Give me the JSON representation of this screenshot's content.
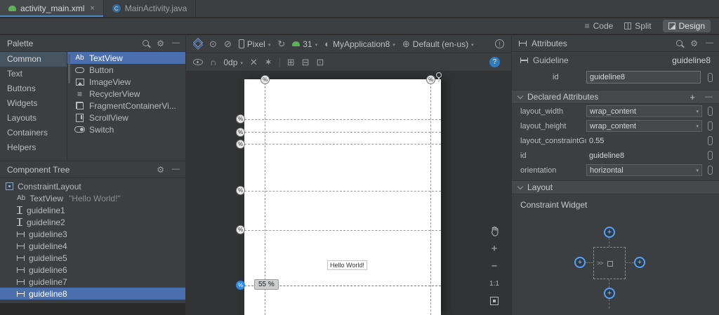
{
  "colors": {
    "selection_blue": "#4b6eaf",
    "tab_underline": "#4a88c7",
    "guideline_selected": "#2e87e5",
    "android_green": "#5fb05c"
  },
  "tabs": [
    {
      "label": "activity_main.xml",
      "close_glyph": "×"
    },
    {
      "label": "MainActivity.java",
      "icon_letter": "C"
    }
  ],
  "mode_switcher": {
    "code": "Code",
    "split": "Split",
    "design": "Design"
  },
  "palette": {
    "title": "Palette",
    "categories": [
      "Common",
      "Text",
      "Buttons",
      "Widgets",
      "Layouts",
      "Containers",
      "Helpers"
    ],
    "components": [
      {
        "label": "TextView",
        "icon_text": "Ab"
      },
      {
        "label": "Button"
      },
      {
        "label": "ImageView"
      },
      {
        "label": "RecyclerView"
      },
      {
        "label": "FragmentContainerVi..."
      },
      {
        "label": "ScrollView"
      },
      {
        "label": "Switch"
      }
    ]
  },
  "component_tree": {
    "title": "Component Tree",
    "items": [
      {
        "label": "ConstraintLayout"
      },
      {
        "label": "TextView",
        "icon_text": "Ab",
        "annotation": "\"Hello World!\""
      },
      {
        "label": "guideline1"
      },
      {
        "label": "guideline2"
      },
      {
        "label": "guideline3"
      },
      {
        "label": "guideline4"
      },
      {
        "label": "guideline5"
      },
      {
        "label": "guideline6"
      },
      {
        "label": "guideline7"
      },
      {
        "label": "guideline8"
      }
    ]
  },
  "design_toolbar": {
    "device": "Pixel",
    "api_level": "31",
    "theme": "MyApplication8",
    "locale": "Default (en-us)",
    "default_margin": "0dp"
  },
  "canvas": {
    "hello_text": "Hello World!",
    "selected_guideline_badge": "55 %",
    "percent_glyph": "%",
    "zoom_one_to_one": "1:1"
  },
  "attributes": {
    "title": "Attributes",
    "component_type": "Guideline",
    "component_id": "guideline8",
    "id_row": {
      "label": "id",
      "value": "guideline8"
    },
    "declared_section_title": "Declared Attributes",
    "rows": [
      {
        "name": "layout_width",
        "value": "wrap_content"
      },
      {
        "name": "layout_height",
        "value": "wrap_content"
      },
      {
        "name": "layout_constraintGui...",
        "value": "0.55"
      },
      {
        "name": "id",
        "value": "guideline8"
      },
      {
        "name": "orientation",
        "value": "horizontal"
      }
    ],
    "layout_section_title": "Layout",
    "constraint_widget_label": "Constraint Widget"
  }
}
